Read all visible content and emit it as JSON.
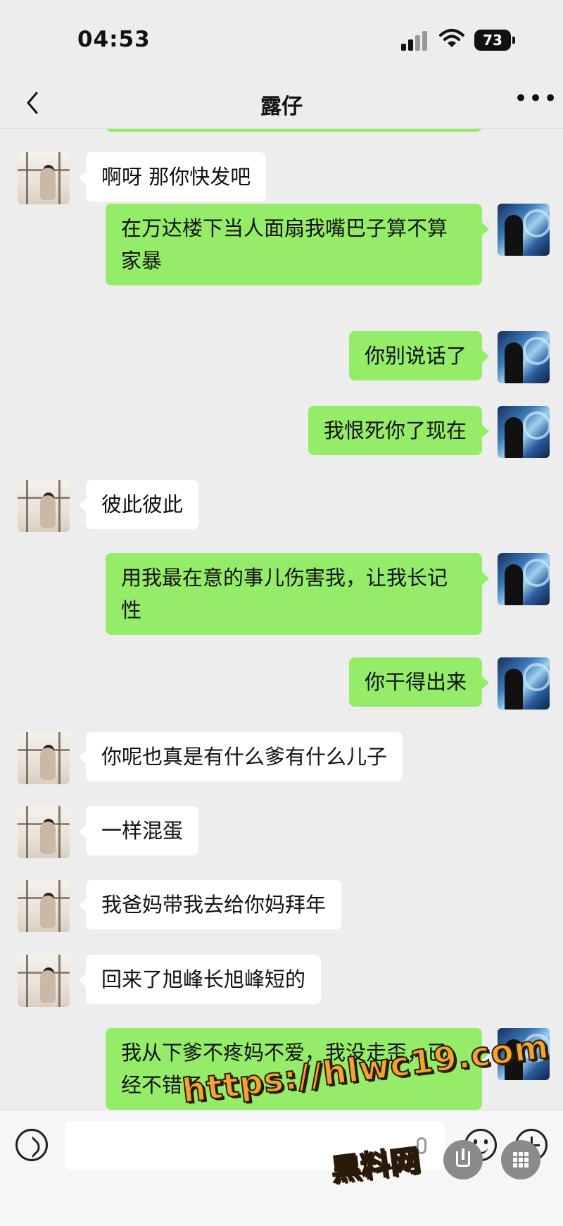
{
  "status_bar": {
    "time": "04:53",
    "battery": "73"
  },
  "header": {
    "title": "露仔"
  },
  "messages": [
    {
      "side": "in",
      "text": "啊呀 那你快发吧"
    },
    {
      "side": "out",
      "text": "在万达楼下当人面扇我嘴巴子算不算家暴"
    },
    {
      "side": "out",
      "text": "你别说话了"
    },
    {
      "side": "out",
      "text": "我恨死你了现在"
    },
    {
      "side": "in",
      "text": "彼此彼此"
    },
    {
      "side": "out",
      "text": "用我最在意的事儿伤害我，让我长记性"
    },
    {
      "side": "out",
      "text": "你干得出来"
    },
    {
      "side": "in",
      "text": "你呢也真是有什么爹有什么儿子"
    },
    {
      "side": "in",
      "text": "一样混蛋"
    },
    {
      "side": "in",
      "text": "我爸妈带我去给你妈拜年"
    },
    {
      "side": "in",
      "text": "回来了旭峰长旭峰短的"
    },
    {
      "side": "out",
      "text": "我从下爹不疼妈不爱，我没走歪，已经不错了"
    }
  ],
  "input": {
    "value": ""
  },
  "watermark": {
    "url": "https://hlwc19.com",
    "site": "黑料网"
  },
  "colors": {
    "outgoing_bubble": "#95ec69",
    "incoming_bubble": "#ffffff",
    "background": "#ededed"
  }
}
